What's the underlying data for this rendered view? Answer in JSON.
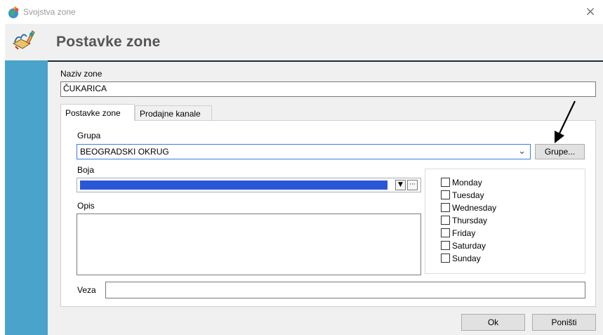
{
  "window": {
    "title": "Svojstva zone",
    "close_glyph": "×"
  },
  "header": {
    "title": "Postavke zone"
  },
  "form": {
    "name_label": "Naziv zone",
    "name_value": "ČUKARICA"
  },
  "tabs": [
    {
      "label": "Postavke zone",
      "active": true
    },
    {
      "label": "Prodajne kanale",
      "active": false
    }
  ],
  "settings": {
    "group_label": "Grupa",
    "group_value": "BEOGRADSKI OKRUG",
    "groups_button": "Grupe...",
    "color_label": "Boja",
    "color_value": "#2a57d6",
    "color_dropdown_glyph": "▼",
    "color_more_glyph": "···",
    "description_label": "Opis",
    "description_value": "",
    "veza_label": "Veza",
    "veza_value": ""
  },
  "days": [
    {
      "label": "Monday",
      "checked": false
    },
    {
      "label": "Tuesday",
      "checked": false
    },
    {
      "label": "Wednesday",
      "checked": false
    },
    {
      "label": "Thursday",
      "checked": false
    },
    {
      "label": "Friday",
      "checked": false
    },
    {
      "label": "Saturday",
      "checked": false
    },
    {
      "label": "Sunday",
      "checked": false
    }
  ],
  "buttons": {
    "ok": "Ok",
    "cancel": "Poništi"
  },
  "colors": {
    "sidebar": "#4aa3cb",
    "header_rule": "#1c2a3a",
    "combo_border": "#3c7fd6"
  },
  "icons": {
    "app": "app-globe-icon",
    "sidebar": "zone-edit-icon",
    "annotation": "annotation-arrow-icon"
  }
}
